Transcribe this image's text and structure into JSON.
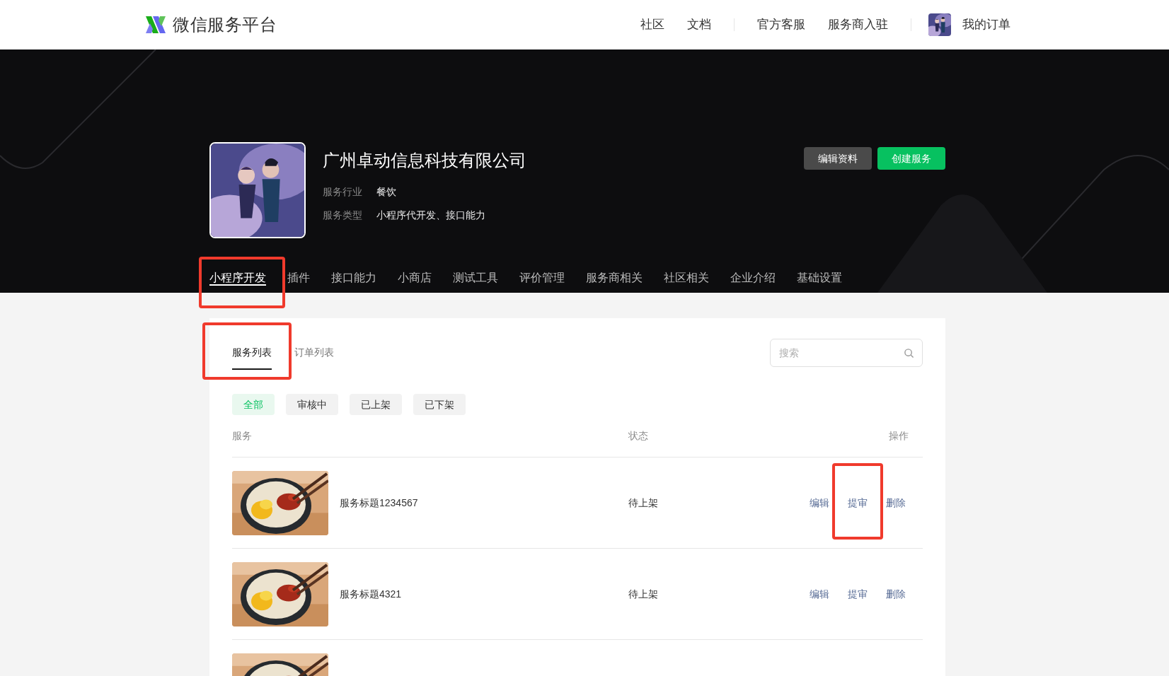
{
  "header": {
    "logo_text": "微信服务平台",
    "nav": [
      {
        "label": "社区",
        "separator_before": false
      },
      {
        "label": "文档",
        "separator_before": false
      },
      {
        "label": "官方客服",
        "separator_before": true
      },
      {
        "label": "服务商入驻",
        "separator_before": false
      }
    ],
    "user": {
      "avatar": {
        "kind": "picture"
      },
      "label": "我的订单"
    }
  },
  "profile": {
    "avatar": {
      "kind": "picture"
    },
    "name": "广州卓动信息科技有限公司",
    "fields": [
      {
        "label": "服务行业",
        "value": "餐饮"
      },
      {
        "label": "服务类型",
        "value": "小程序代开发、接口能力"
      }
    ],
    "buttons": [
      {
        "label": "编辑资料",
        "kind": "secondary"
      },
      {
        "label": "创建服务",
        "kind": "primary"
      }
    ]
  },
  "tabs": [
    {
      "label": "小程序开发",
      "selected": true,
      "highlighted": true
    },
    {
      "label": "插件",
      "selected": false,
      "highlighted": false
    },
    {
      "label": "接口能力",
      "selected": false,
      "highlighted": false
    },
    {
      "label": "小商店",
      "selected": false,
      "highlighted": false
    },
    {
      "label": "测试工具",
      "selected": false,
      "highlighted": false
    },
    {
      "label": "评价管理",
      "selected": false,
      "highlighted": false
    },
    {
      "label": "服务商相关",
      "selected": false,
      "highlighted": false
    },
    {
      "label": "社区相关",
      "selected": false,
      "highlighted": false
    },
    {
      "label": "企业介绍",
      "selected": false,
      "highlighted": false
    },
    {
      "label": "基础设置",
      "selected": false,
      "highlighted": false
    }
  ],
  "subtabs": [
    {
      "label": "服务列表",
      "selected": true,
      "highlighted": true
    },
    {
      "label": "订单列表",
      "selected": false,
      "highlighted": false
    }
  ],
  "search": {
    "placeholder": "搜索"
  },
  "filters": [
    {
      "label": "全部",
      "selected": true
    },
    {
      "label": "审核中",
      "selected": false
    },
    {
      "label": "已上架",
      "selected": false
    },
    {
      "label": "已下架",
      "selected": false
    }
  ],
  "table": {
    "columns": [
      "服务",
      "状态",
      "操作"
    ],
    "rows": [
      {
        "thumbnail": {
          "kind": "picture"
        },
        "title": "服务标题1234567",
        "status": "待上架",
        "actions": [
          {
            "label": "编辑",
            "highlighted": false
          },
          {
            "label": "提审",
            "highlighted": true
          },
          {
            "label": "删除",
            "highlighted": false
          }
        ]
      },
      {
        "thumbnail": {
          "kind": "picture"
        },
        "title": "服务标题4321",
        "status": "待上架",
        "actions": [
          {
            "label": "编辑",
            "highlighted": false
          },
          {
            "label": "提审",
            "highlighted": false
          },
          {
            "label": "删除",
            "highlighted": false
          }
        ]
      },
      {
        "thumbnail": {
          "kind": "picture"
        }
      }
    ]
  }
}
